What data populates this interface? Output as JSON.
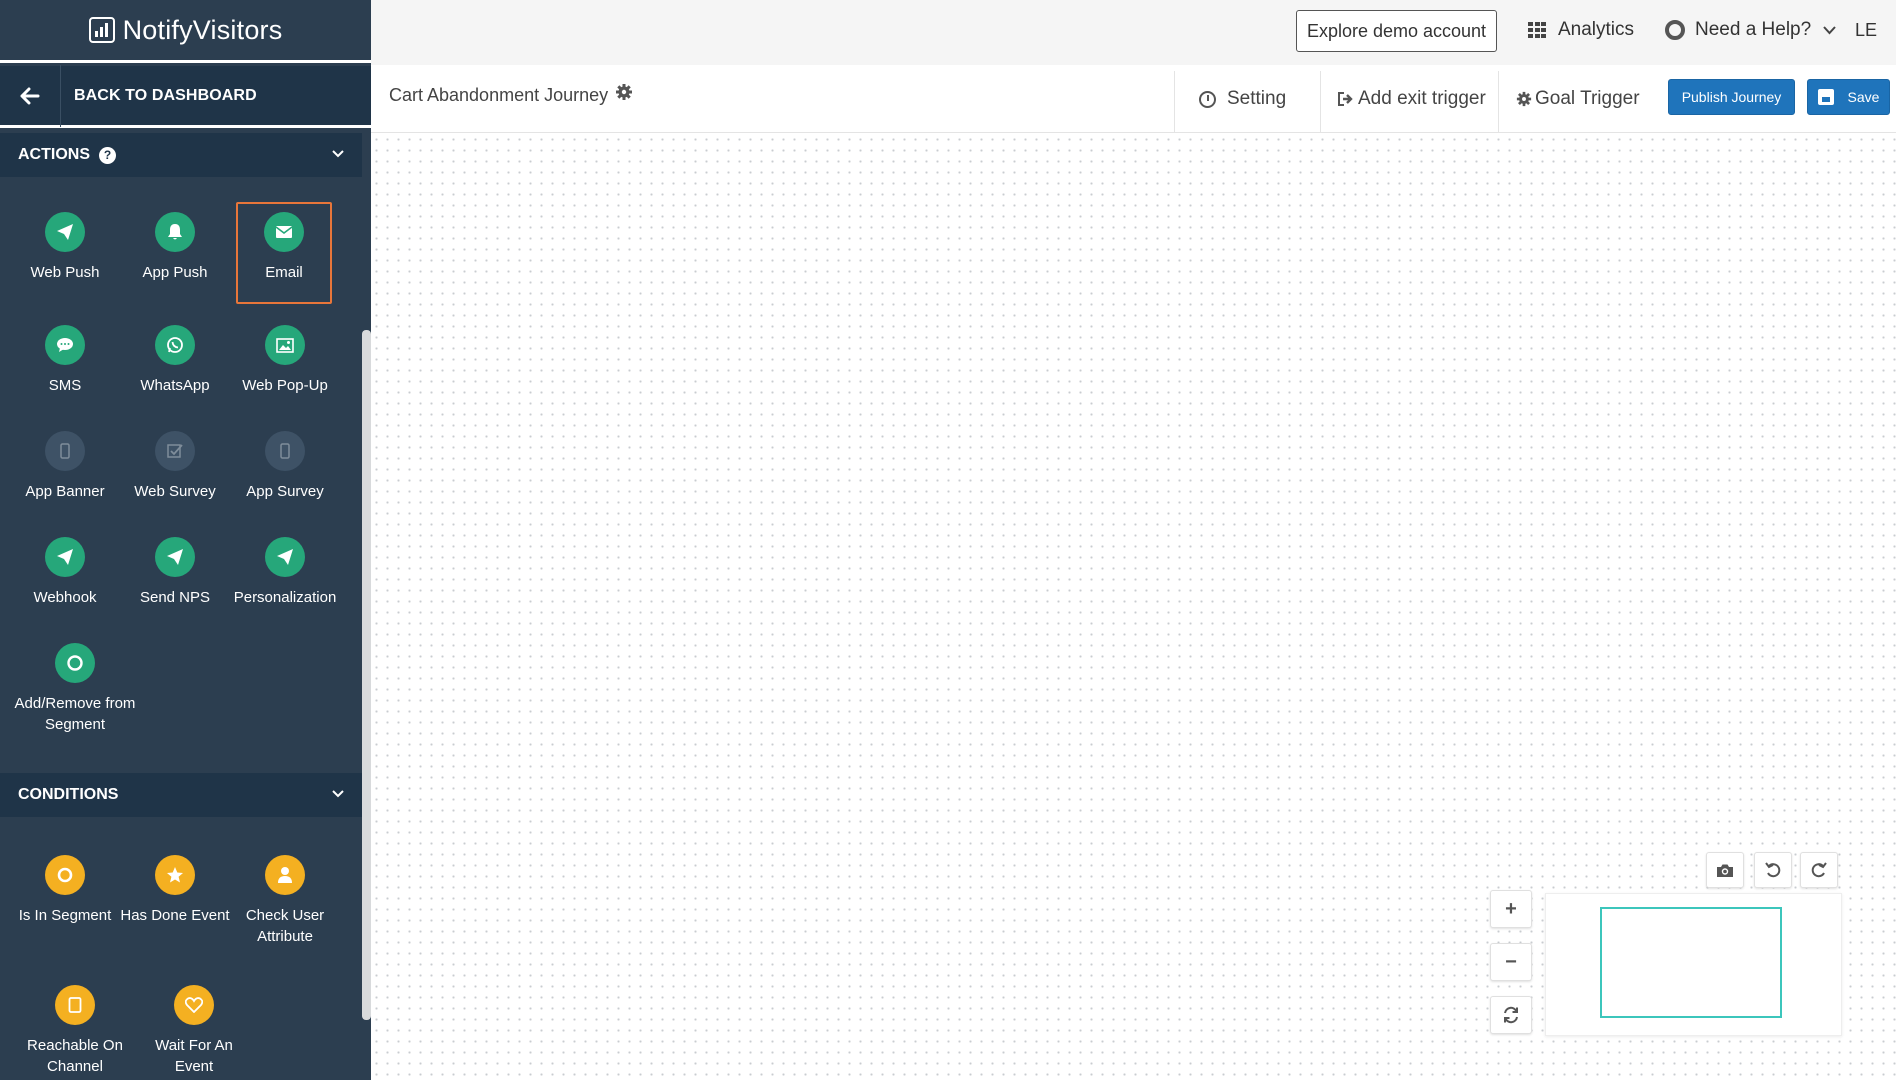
{
  "sidebar": {
    "logo_text": "NotifyVisitors",
    "back_label": "BACK TO DASHBOARD",
    "actions": {
      "title": "ACTIONS",
      "items": [
        {
          "label": "Web Push",
          "icon": "paper-plane-icon",
          "state": "enabled"
        },
        {
          "label": "App Push",
          "icon": "bell-icon",
          "state": "enabled"
        },
        {
          "label": "Email",
          "icon": "envelope-icon",
          "state": "selected"
        },
        {
          "label": "SMS",
          "icon": "chat-bubble-icon",
          "state": "enabled"
        },
        {
          "label": "WhatsApp",
          "icon": "whatsapp-icon",
          "state": "enabled"
        },
        {
          "label": "Web Pop-Up",
          "icon": "image-icon",
          "state": "enabled"
        },
        {
          "label": "App Banner",
          "icon": "mobile-icon",
          "state": "disabled"
        },
        {
          "label": "Web Survey",
          "icon": "checkbox-icon",
          "state": "disabled"
        },
        {
          "label": "App Survey",
          "icon": "mobile-icon",
          "state": "disabled"
        },
        {
          "label": "Webhook",
          "icon": "paper-plane-icon",
          "state": "enabled"
        },
        {
          "label": "Send NPS",
          "icon": "paper-plane-icon",
          "state": "enabled"
        },
        {
          "label": "Personalization",
          "icon": "paper-plane-icon",
          "state": "enabled"
        },
        {
          "label": "Add/Remove from Segment",
          "icon": "circle-icon",
          "state": "enabled"
        }
      ]
    },
    "conditions": {
      "title": "CONDITIONS",
      "items": [
        {
          "label": "Is In Segment",
          "icon": "ring-icon"
        },
        {
          "label": "Has Done Event",
          "icon": "star-icon"
        },
        {
          "label": "Check User Attribute",
          "icon": "user-icon"
        },
        {
          "label": "Reachable On Channel",
          "icon": "tablet-icon"
        },
        {
          "label": "Wait For An Event",
          "icon": "heart-icon"
        }
      ]
    }
  },
  "header": {
    "explore_label": "Explore demo account",
    "analytics_label": "Analytics",
    "help_label": "Need a Help?",
    "user_initials": "LE"
  },
  "toolbar": {
    "journey_title": "Cart Abandonment Journey",
    "setting_label": "Setting",
    "exit_trigger_label": "Add exit trigger",
    "goal_trigger_label": "Goal Trigger",
    "publish_label": "Publish Journey",
    "save_label": "Save"
  },
  "canvas_controls": {
    "zoom_in": "+",
    "zoom_out": "−",
    "screenshot_icon": "camera-icon",
    "undo_icon": "undo-icon",
    "redo_icon": "redo-icon",
    "reset_icon": "refresh-icon"
  },
  "colors": {
    "sidebar_bg": "#2c3e50",
    "section_bg": "#1f3448",
    "action_icon": "#26a77a",
    "condition_icon": "#f4b021",
    "selected_border": "#e8763a",
    "primary_button": "#1f74bb",
    "minimap_viewport": "#3cc6bc"
  }
}
